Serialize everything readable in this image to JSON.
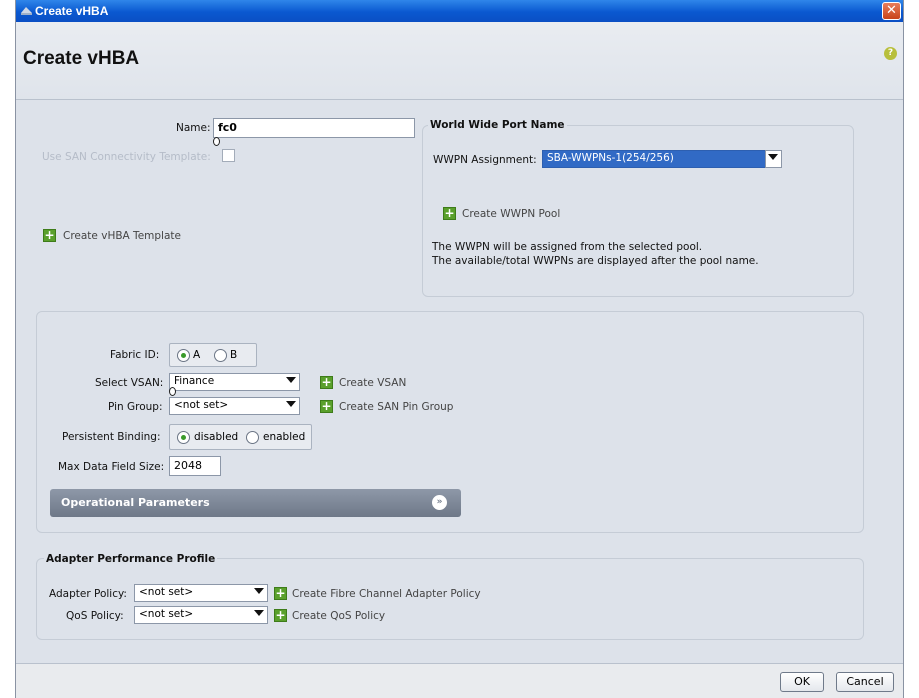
{
  "window": {
    "title": "Create vHBA",
    "close_glyph": "✕"
  },
  "header": {
    "title": "Create vHBA",
    "help_glyph": "?"
  },
  "name_field": {
    "label": "Name:",
    "value": "fc0"
  },
  "san_template": {
    "label": "Use SAN Connectivity Template:",
    "checked": false
  },
  "create_vhba_template": {
    "label": "Create vHBA Template"
  },
  "wwpn": {
    "title": "World Wide Port Name",
    "assignment_label": "WWPN Assignment:",
    "assignment_value": "SBA-WWPNs-1(254/256)",
    "create_pool_label": "Create WWPN Pool",
    "info_line1": "The WWPN will be assigned from the selected pool.",
    "info_line2": "The available/total WWPNs are displayed after the pool name."
  },
  "fabric": {
    "label": "Fabric ID:",
    "options": [
      "A",
      "B"
    ],
    "selected": "A"
  },
  "vsan": {
    "label": "Select VSAN:",
    "value": "Finance",
    "create_label": "Create VSAN"
  },
  "pin_group": {
    "label": "Pin Group:",
    "value": "<not set>",
    "create_label": "Create SAN Pin Group"
  },
  "persistent_binding": {
    "label": "Persistent Binding:",
    "options": [
      "disabled",
      "enabled"
    ],
    "selected": "disabled"
  },
  "max_data": {
    "label": "Max Data Field Size:",
    "value": "2048"
  },
  "operational": {
    "label": "Operational Parameters"
  },
  "adapter_profile": {
    "title": "Adapter Performance Profile",
    "adapter_policy_label": "Adapter Policy:",
    "adapter_policy_value": "<not set>",
    "create_adapter_label": "Create Fibre Channel Adapter Policy",
    "qos_label": "QoS Policy:",
    "qos_value": "<not set>",
    "create_qos_label": "Create QoS Policy"
  },
  "buttons": {
    "ok": "OK",
    "cancel": "Cancel"
  },
  "colors": {
    "titlebar": "#0a58d0",
    "selection": "#316ac5",
    "add_icon": "#5aa02c",
    "background": "#dde2ea"
  }
}
